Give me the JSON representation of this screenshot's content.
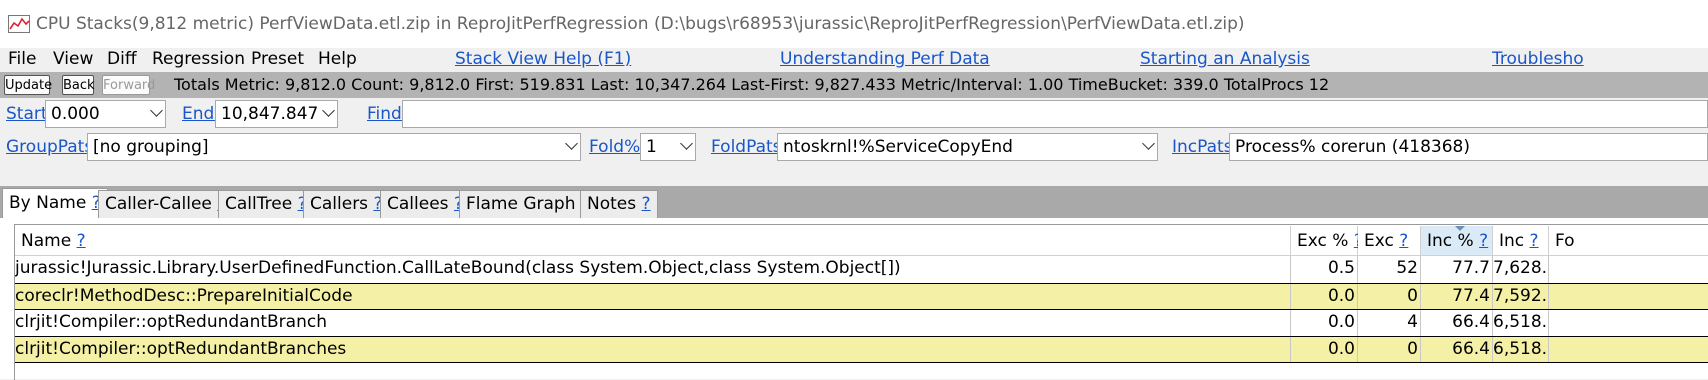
{
  "window": {
    "title": "CPU Stacks(9,812 metric) PerfViewData.etl.zip in ReproJitPerfRegression (D:\\bugs\\r68953\\jurassic\\ReproJitPerfRegression\\PerfViewData.etl.zip)"
  },
  "menu": {
    "file": "File",
    "view": "View",
    "diff": "Diff",
    "regression": "Regression",
    "preset": "Preset",
    "help": "Help"
  },
  "help_links": {
    "stack_view_help": "Stack View Help (F1)",
    "understanding": "Understanding Perf Data",
    "starting": "Starting an Analysis",
    "troubleshooting": "Troublesho"
  },
  "toolbar": {
    "update": "Update",
    "back": "Back",
    "forward": "Forward",
    "totals": "Totals Metric: 9,812.0  Count: 9,812.0  First: 519.831  Last: 10,347.264  Last-First: 9,827.433  Metric/Interval: 1.00  TimeBucket: 339.0  TotalProcs 12"
  },
  "filters": {
    "start_label": "Start:",
    "start_value": "0.000",
    "end_label": "End:",
    "end_value": "10,847.847",
    "find_label": "Find:",
    "find_value": "",
    "grouppats_label": "GroupPats:",
    "grouppats_value": "[no grouping]",
    "foldpct_label": "Fold%:",
    "foldpct_value": "1",
    "foldpats_label": "FoldPats:",
    "foldpats_value": "ntoskrnl!%ServiceCopyEnd",
    "incpats_label": "IncPats:",
    "incpats_value": "Process% corerun (418368)"
  },
  "tabs": [
    {
      "label": "By Name",
      "q": "?"
    },
    {
      "label": "Caller-Callee",
      "q": "?"
    },
    {
      "label": "CallTree",
      "q": "?"
    },
    {
      "label": "Callers",
      "q": "?"
    },
    {
      "label": "Callees",
      "q": "?"
    },
    {
      "label": "Flame Graph",
      "q": "?"
    },
    {
      "label": "Notes",
      "q": "?"
    }
  ],
  "table": {
    "columns": {
      "name": "Name",
      "exc_pct": "Exc %",
      "exc": "Exc",
      "inc_pct": "Inc %",
      "inc": "Inc",
      "fold": "Fo",
      "q": "?"
    },
    "rows": [
      {
        "name": "jurassic!Jurassic.Library.UserDefinedFunction.CallLateBound(class System.Object,class System.Object[])",
        "exc_pct": "0.5",
        "exc": "52",
        "inc_pct": "77.7",
        "inc": "7,628.0"
      },
      {
        "name": "coreclr!MethodDesc::PrepareInitialCode",
        "exc_pct": "0.0",
        "exc": "0",
        "inc_pct": "77.4",
        "inc": "7,592.0"
      },
      {
        "name": "clrjit!Compiler::optRedundantBranch",
        "exc_pct": "0.0",
        "exc": "4",
        "inc_pct": "66.4",
        "inc": "6,518.0"
      },
      {
        "name": "clrjit!Compiler::optRedundantBranches",
        "exc_pct": "0.0",
        "exc": "0",
        "inc_pct": "66.4",
        "inc": "6,518.0"
      }
    ]
  },
  "colors": {
    "link": "#1a56c8",
    "highlight_row": "#f4f1a6",
    "status_bar": "#b3b3b3",
    "tab_strip": "#a9a9a9"
  },
  "icons": {
    "app": "chart-icon",
    "dropdown": "chevron-down-icon",
    "sort": "sort-descending-icon"
  }
}
